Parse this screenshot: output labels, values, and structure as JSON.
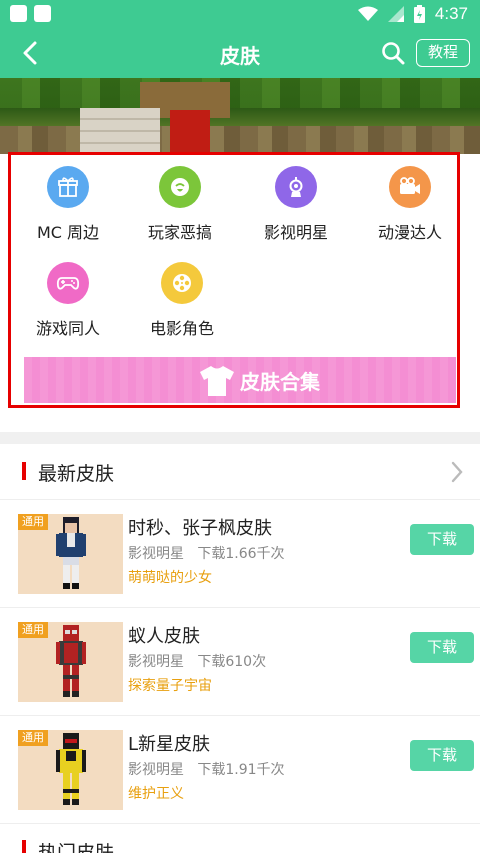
{
  "status_bar": {
    "time": "4:37"
  },
  "app_bar": {
    "title": "皮肤",
    "tutorial_label": "教程"
  },
  "categories": [
    {
      "label": "MC 周边",
      "icon": "gift-icon",
      "color": "#5aa9f0"
    },
    {
      "label": "玩家恶搞",
      "icon": "smile-face-icon",
      "color": "#7cc63a"
    },
    {
      "label": "影视明星",
      "icon": "trophy-icon",
      "color": "#8f67e8"
    },
    {
      "label": "动漫达人",
      "icon": "video-camera-icon",
      "color": "#f4964a"
    },
    {
      "label": "游戏同人",
      "icon": "gamepad-icon",
      "color": "#f06ac6"
    },
    {
      "label": "电影角色",
      "icon": "film-reel-icon",
      "color": "#f4c93c"
    }
  ],
  "collection_button": {
    "label": "皮肤合集",
    "color": "#f48ed3"
  },
  "latest": {
    "title": "最新皮肤",
    "items": [
      {
        "tag": "通用",
        "name": "时秒、张子枫皮肤",
        "category": "影视明星",
        "downloads": "下载1.66千次",
        "author": "萌萌哒的少女",
        "download_label": "下载"
      },
      {
        "tag": "通用",
        "name": "蚁人皮肤",
        "category": "影视明星",
        "downloads": "下载610次",
        "author": "探索量子宇宙",
        "download_label": "下载"
      },
      {
        "tag": "通用",
        "name": "L新星皮肤",
        "category": "影视明星",
        "downloads": "下载1.91千次",
        "author": "维护正义",
        "download_label": "下载"
      }
    ]
  },
  "hot": {
    "title": "热门皮肤"
  },
  "colors": {
    "primary": "#3ecb92",
    "download_button": "#56d5a6",
    "accent_red": "#e60000",
    "author_orange": "#e8a010",
    "tag_orange": "#f0a020"
  }
}
